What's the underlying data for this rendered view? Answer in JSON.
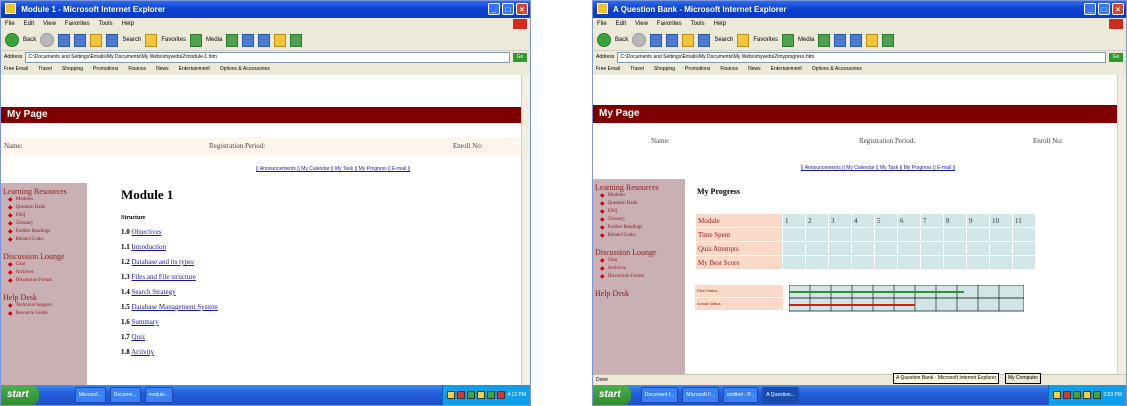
{
  "windowA": {
    "title": "Module 1 - Microsoft Internet Explorer",
    "menu": [
      "File",
      "Edit",
      "View",
      "Favorites",
      "Tools",
      "Help"
    ],
    "toolbar": {
      "back": "Back",
      "search": "Search",
      "favorites": "Favorites",
      "media": "Media"
    },
    "address_label": "Address",
    "address": "C:\\Documents and Settings\\Emalis\\My Documents\\My Webs\\mywebs2\\module-1.htm",
    "go": "Go",
    "links": [
      "Free Email",
      "Travel",
      "Shopping",
      "Promotions",
      "Finance",
      "News",
      "Entertainment",
      "Options & Accessories"
    ],
    "page_title": "My Page",
    "header": {
      "name": "Name:",
      "period": "Registration Period:",
      "enroll": "Enroll No:"
    },
    "nav_links": "|| Announcements || My Calendar || My Task || My Progress || E-mail ||",
    "sidebar": {
      "learning_heading": "Learning Resources",
      "learning_items": [
        "Modules",
        "Question Bank",
        "FAQ",
        "Glossary",
        "Further Readings",
        "Related Links"
      ],
      "discussion_heading": "Discussion Lounge",
      "discussion_items": [
        "Chat",
        "Archives",
        "Discussion Forum"
      ],
      "help_heading": "Help Desk",
      "help_items": [
        "Technical Support",
        "Resource Guide"
      ]
    },
    "module_title": "Module 1",
    "structure_label": "Structure",
    "items": [
      {
        "num": "1.0",
        "label": "Objectives"
      },
      {
        "num": "1.1",
        "label": "Introduction"
      },
      {
        "num": "1.2",
        "label": "Database and its types"
      },
      {
        "num": "1.3",
        "label": "Files and File structure"
      },
      {
        "num": "1.4",
        "label": "Search Strategy"
      },
      {
        "num": "1.5",
        "label": "Database Management System"
      },
      {
        "num": "1.6",
        "label": "Summary"
      },
      {
        "num": "1.7",
        "label": "Quiz"
      },
      {
        "num": "1.8",
        "label": "Activity"
      }
    ],
    "taskbar": {
      "start": "start",
      "buttons": [
        "Microsof...",
        "Docume...",
        "module..."
      ],
      "clock": "4:12 PM"
    }
  },
  "windowB": {
    "title": "A Question Bank - Microsoft Internet Explorer",
    "menu": [
      "File",
      "Edit",
      "View",
      "Favorites",
      "Tools",
      "Help"
    ],
    "toolbar": {
      "back": "Back",
      "search": "Search",
      "favorites": "Favorites",
      "media": "Media"
    },
    "address_label": "Address",
    "address": "C:\\Documents and Settings\\Emalis\\My Documents\\My Webs\\mywebs2\\myprogress.htm",
    "go": "Go",
    "links": [
      "Free Email",
      "Travel",
      "Shopping",
      "Promotions",
      "Finance",
      "News",
      "Entertainment",
      "Options & Accessories"
    ],
    "page_title": "My Page",
    "header": {
      "name": "Name:",
      "period": "Registration Period:",
      "enroll": "Enroll No:"
    },
    "nav_links": "|| Announcements || My Calendar || My Task || My Progress || E-mail ||",
    "sidebar": {
      "learning_heading": "Learning Resources",
      "learning_items": [
        "Modules",
        "Question Bank",
        "FAQ",
        "Glossary",
        "Further Readings",
        "Related Links"
      ],
      "discussion_heading": "Discussion Lounge",
      "discussion_items": [
        "Chat",
        "Archives",
        "Discussion Forum"
      ],
      "help_heading": "Help Desk"
    },
    "progress_title": "My Progress",
    "progress_rows": [
      "Module",
      "Time Spent",
      "Quiz Attempts",
      "My Best Score"
    ],
    "module_columns": [
      "1",
      "2",
      "3",
      "4",
      "5",
      "6",
      "7",
      "8",
      "9",
      "10",
      "11"
    ],
    "gantt_labels": [
      "Plan Status",
      "Actual Status"
    ],
    "status_text": "Done",
    "tooltip": "A Question Bank - Microsoft Internet Explorer",
    "tooltip_right": "My Computer",
    "taskbar": {
      "start": "start",
      "buttons": [
        "Document f...",
        "Microsoft F...",
        "untitled - P...",
        "A Question..."
      ],
      "clock": "2:53 PM"
    }
  },
  "colors": {
    "title_blue": "#0a3fcf",
    "banner": "#800000",
    "sidebar": "#c9b0b4",
    "link": "#1a1aa8",
    "row_label": "#fbd9c9",
    "cell": "#d1e6e6"
  }
}
